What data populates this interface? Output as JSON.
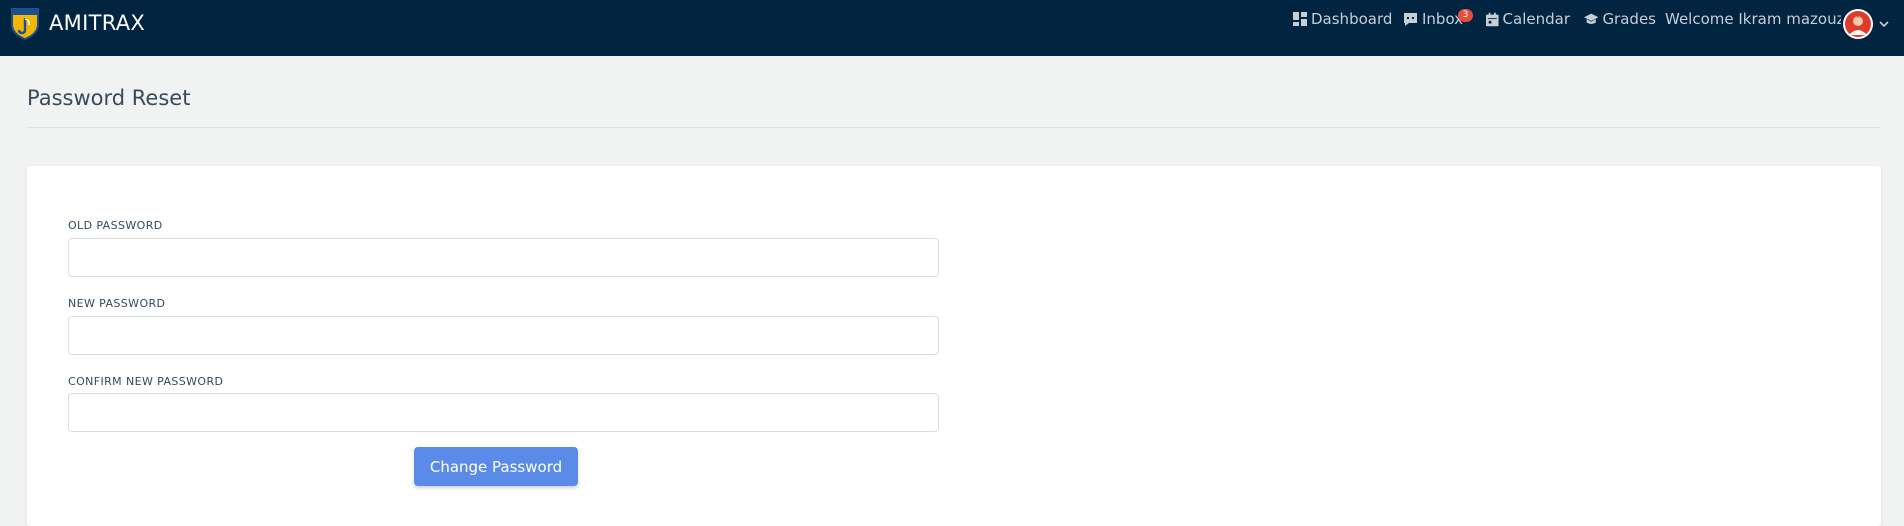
{
  "brand": {
    "name": "AMITRAX",
    "logo_icon": "amitrax-shield-logo"
  },
  "nav": {
    "dashboard": "Dashboard",
    "inbox": "Inbox",
    "inbox_badge": "3",
    "calendar": "Calendar",
    "grades": "Grades",
    "welcome": "Welcome Ikram mazouzi!"
  },
  "page": {
    "title": "Password Reset"
  },
  "form": {
    "old_password_label": "OLD PASSWORD",
    "new_password_label": "NEW PASSWORD",
    "confirm_password_label": "CONFIRM NEW PASSWORD",
    "old_password_value": "",
    "new_password_value": "",
    "confirm_password_value": "",
    "submit_label": "Change Password"
  },
  "colors": {
    "topbar": "#012440",
    "badge": "#e74c3c",
    "button": "#5b8be8",
    "background": "#f1f2f2"
  }
}
